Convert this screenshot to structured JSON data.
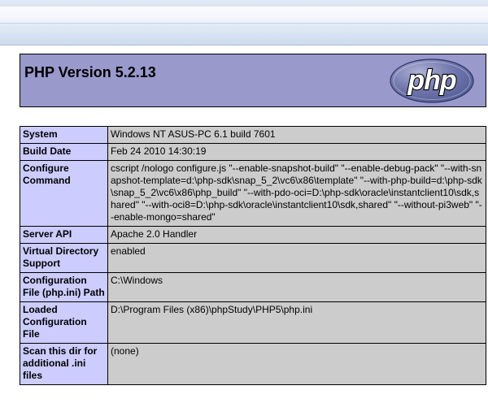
{
  "header": {
    "title": "PHP Version 5.2.13",
    "logo_text": "php"
  },
  "rows": [
    {
      "key": "System",
      "value": "Windows NT ASUS-PC 6.1 build 7601"
    },
    {
      "key": "Build Date",
      "value": "Feb 24 2010 14:30:19"
    },
    {
      "key": "Configure Command",
      "value": "cscript /nologo configure.js \"--enable-snapshot-build\" \"--enable-debug-pack\" \"--with-snapshot-template=d:\\php-sdk\\snap_5_2\\vc6\\x86\\template\" \"--with-php-build=d:\\php-sdk\\snap_5_2\\vc6\\x86\\php_build\" \"--with-pdo-oci=D:\\php-sdk\\oracle\\instantclient10\\sdk,shared\" \"--with-oci8=D:\\php-sdk\\oracle\\instantclient10\\sdk,shared\" \"--without-pi3web\" \"--enable-mongo=shared\""
    },
    {
      "key": "Server API",
      "value": "Apache 2.0 Handler"
    },
    {
      "key": "Virtual Directory Support",
      "value": "enabled"
    },
    {
      "key": "Configuration File (php.ini) Path",
      "value": "C:\\Windows"
    },
    {
      "key": "Loaded Configuration File",
      "value": "D:\\Program Files (x86)\\phpStudy\\PHP5\\php.ini"
    },
    {
      "key": "Scan this dir for additional .ini files",
      "value": "(none)"
    }
  ]
}
